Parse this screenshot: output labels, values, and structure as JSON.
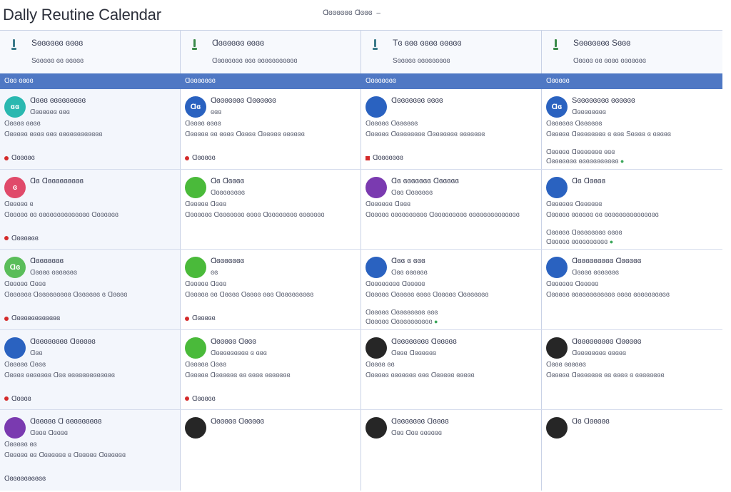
{
  "app": {
    "title": "Dally Reutine Calendar",
    "view_label": "Ɑɞɞɞɞɞɞ Ɑɞɞɞ",
    "caret": "–"
  },
  "colors": {
    "band": "#4f78c4",
    "status_red": "#d42a2a",
    "ok_green": "#3aa65a"
  },
  "columns": [
    {
      "icon": "pin-icon",
      "title": "Sɞɞɞɞɞɞ ɞɞɞɞ",
      "subtitle": "Sɞɞɞɞɞ ɞɞ ɞɞɞɞɞ",
      "band": "Ɑɞɞ ɞɞɞɞ"
    },
    {
      "icon": "pin-icon",
      "title": "Ɑɞɞɞɞɞɞ ɞɞɞɞ",
      "subtitle": "Ɑɞɞɞɞɞɞɞ ɞɞɞ ɞɞɞɞɞɞɞɞɞɞɞ",
      "band": "Ɑɞɞɞɞɞɞɞ"
    },
    {
      "icon": "pin-icon",
      "title": "Tɞ ɞɞɞ ɞɞɞɞ ɞɞɞɞɞ",
      "subtitle": "Sɞɞɞɞɞ ɞɞɞɞɞɞɞɞɞ",
      "band": "Ɑɞɞɞɞɞɞɞ"
    },
    {
      "icon": "pin-icon",
      "title": "Sɞɞɞɞɞɞɞ Sɞɞɞ",
      "subtitle": "Ɑɞɞɞɞ ɞɞ ɞɞɞɞ ɞɞɞɞɞɞɞ",
      "band": "Ɑɞɞɞɞɞ"
    }
  ],
  "rows": [
    [
      {
        "badge_color": "#2ab8b0",
        "badge_text": "ɞɞ",
        "title": "Ɑɞɞɞ ɞɞɞɞɞɞɞɞɞ",
        "sub": "Ɑɞɞɞɞɞɞ ɞɞɞ",
        "line1": "Ɑɞɞɞɞ ɞɞɞɞ",
        "line2": "Ɑɞɞɞɞɞ ɞɞɞɞ ɞɞɞ ɞɞɞɞɞɞɞɞɞɞɞɞ",
        "status": "Ɑɞɞɞɞɞ",
        "marker": "dot"
      },
      {
        "badge_color": "#2a62c0",
        "badge_text": "Ɑɞ",
        "title": "Ɑɞɞɞɞɞɞɞ Ɑɞɞɞɞɞɞ",
        "sub": "ɞɞɞ",
        "line1": "Ɑɞɞɞɞ ɞɞɞɞ",
        "line2": "Ɑɞɞɞɞɞ ɞɞ ɞɞɞɞ Ɑɞɞɞɞ Ɑɞɞɞɞɞ ɞɞɞɞɞɞ",
        "status": "Ɑɞɞɞɞɞ",
        "marker": "dot"
      },
      {
        "badge_color": "#2a62c0",
        "badge_text": "",
        "title": "Ɑɞɞɞɞɞɞɞ ɞɞɞɞ",
        "sub": "",
        "line1": "Ɑɞɞɞɞɞ Ɑɞɞɞɞɞɞ",
        "line2": "Ɑɞɞɞɞɞ Ɑɞɞɞɞɞɞɞɞ Ɑɞɞɞɞɞɞɞ ɞɞɞɞɞɞɞ",
        "status": "Ɑɞɞɞɞɞɞɞ",
        "marker": "sq"
      },
      {
        "badge_color": "#2a62c0",
        "badge_text": "Ɑɞ",
        "title": "Sɞɞɞɞɞɞɞɞ ɞɞɞɞɞɞ",
        "sub": "Ɑɞɞɞɞɞɞɞɞ",
        "line1": "Ɑɞɞɞɞɞɞ Ɑɞɞɞɞɞɞ",
        "line2": "Ɑɞɞɞɞɞ Ɑɞɞɞɞɞɞɞɞ ɞ ɞɞɞ Sɞɞɞɞ ɞ ɞɞɞɞɞ",
        "note1": "Ɑɞɞɞɞɞ Ɑɞɞɞɞɞɞɞ ɞɞɞ",
        "note2": "Ɑɞɞɞɞɞɞɞ ɞɞɞɞɞɞɞɞɞɞɞ",
        "status": "",
        "marker": ""
      }
    ],
    [
      {
        "badge_color": "#e04a6a",
        "badge_text": "ɞ",
        "title": "Ɑɞ Ɑɞɞɞɞɞɞɞɞɞ",
        "sub": "",
        "line1": "Ɑɞɞɞɞɞ ɞ",
        "line2": "Ɑɞɞɞɞɞ ɞɞ ɞɞɞɞɞɞɞɞɞɞɞɞɞɞ Ɑɞɞɞɞɞɞ",
        "status": "Ɑɞɞɞɞɞɞ",
        "marker": "dot"
      },
      {
        "badge_color": "#4aba3a",
        "badge_text": "",
        "title": "Ɑɞ Ɑɞɞɞɞ",
        "sub": "Ɑɞɞɞɞɞɞɞɞ",
        "line1": "Ɑɞɞɞɞɞ Ɑɞɞɞ",
        "line2": "Ɑɞɞɞɞɞɞ Ɑɞɞɞɞɞɞɞ ɞɞɞɞ Ɑɞɞɞɞɞɞɞɞ ɞɞɞɞɞɞɞ",
        "status": "",
        "marker": ""
      },
      {
        "badge_color": "#7a3ab0",
        "badge_text": "",
        "title": "Ɑɞ ɞɞɞɞɞɞɞ Ɑɞɞɞɞɞ",
        "sub": "Ɑɞɞ Ɑɞɞɞɞɞɞ",
        "line1": "Ɑɞɞɞɞɞɞ Ɑɞɞɞ",
        "line2": "Ɑɞɞɞɞɞ ɞɞɞɞɞɞɞɞɞɞ Ɑɞɞɞɞɞɞɞɞɞ ɞɞɞɞɞɞɞɞɞɞɞɞɞɞ",
        "status": "",
        "marker": ""
      },
      {
        "badge_color": "#2a62c0",
        "badge_text": "",
        "title": "Ɑɞ Ɑɞɞɞɞ",
        "sub": "",
        "line1": "Ɑɞɞɞɞɞɞ Ɑɞɞɞɞɞɞ",
        "line2": "Ɑɞɞɞɞɞ ɞɞɞɞɞɞ ɞɞ ɞɞɞɞɞɞɞɞɞɞɞɞɞɞɞ",
        "note1": "Ɑɞɞɞɞɞ Ɑɞɞɞɞɞɞɞɞ ɞɞɞɞ",
        "note2": "Ɑɞɞɞɞɞ ɞɞɞɞɞɞɞɞɞɞ",
        "status": "",
        "marker": ""
      }
    ],
    [
      {
        "badge_color": "#5abd5a",
        "badge_text": "Ɑɞ",
        "title": "Ɑɞɞɞɞɞɞɞ",
        "sub": "Ɑɞɞɞɞ ɞɞɞɞɞɞɞ",
        "line1": "Ɑɞɞɞɞɞ Ɑɞɞɞ",
        "line2": "Ɑɞɞɞɞɞɞ Ɑɞɞɞɞɞɞɞɞɞ Ɑɞɞɞɞɞɞ ɞ Ɑɞɞɞɞ",
        "status": "Ɑɞɞɞɞɞɞɞɞɞɞɞɞ",
        "marker": "dot"
      },
      {
        "badge_color": "#4aba3a",
        "badge_text": "",
        "title": "Ɑɞɞɞɞɞɞɞ",
        "sub": "ɞɞ",
        "line1": "Ɑɞɞɞɞɞ Ɑɞɞɞ",
        "line2": "Ɑɞɞɞɞɞ ɞɞ Ɑɞɞɞɞ Ɑɞɞɞɞ ɞɞɞ Ɑɞɞɞɞɞɞɞɞɞ",
        "status": "Ɑɞɞɞɞɞ",
        "marker": "dot"
      },
      {
        "badge_color": "#2a62c0",
        "badge_text": "",
        "title": "Ɑɞɞ ɞ ɞɞɞ",
        "sub": "Ɑɞɞ ɞɞɞɞɞɞ",
        "line1": "Ɑɞɞɞɞɞɞɞɞ Ɑɞɞɞɞɞ",
        "line2": "Ɑɞɞɞɞɞ Ɑɞɞɞɞɞ ɞɞɞɞ Ɑɞɞɞɞɞ Ɑɞɞɞɞɞɞɞ",
        "note1": "Ɑɞɞɞɞɞ Ɑɞɞɞɞɞɞɞɞ ɞɞɞ",
        "note2": "Ɑɞɞɞɞɞ Ɑɞɞɞɞɞɞɞɞɞɞ",
        "status": "",
        "marker": ""
      },
      {
        "badge_color": "#2a62c0",
        "badge_text": "",
        "title": "Ɑɞɞɞɞɞɞɞɞɞ Ɑɞɞɞɞɞ",
        "sub": "Ɑɞɞɞɞ ɞɞɞɞɞɞɞ",
        "line1": "Ɑɞɞɞɞɞɞ Ɑɞɞɞɞɞ",
        "line2": "Ɑɞɞɞɞɞ ɞɞɞɞɞɞɞɞɞɞɞɞ ɞɞɞɞ ɞɞɞɞɞɞɞɞɞɞ",
        "status": "",
        "marker": ""
      }
    ],
    [
      {
        "badge_color": "#2a62c0",
        "badge_text": "",
        "title": "Ɑɞɞɞɞɞɞɞɞ Ɑɞɞɞɞɞ",
        "sub": "Ɑɞɞ",
        "line1": "Ɑɞɞɞɞɞ Ɑɞɞɞ",
        "line2": "Ɑɞɞɞɞ ɞɞɞɞɞɞɞ Ɑɞɞ ɞɞɞɞɞɞɞɞɞɞɞɞɞ",
        "status": "Ɑɞɞɞɞ",
        "marker": "dot"
      },
      {
        "badge_color": "#4aba3a",
        "badge_text": "",
        "title": "Ɑɞɞɞɞɞ Ɑɞɞɞ",
        "sub": "Ɑɞɞɞɞɞɞɞɞɞ ɞ ɞɞɞ",
        "line1": "Ɑɞɞɞɞɞ Ɑɞɞɞ",
        "line2": "Ɑɞɞɞɞɞ Ɑɞɞɞɞɞɞ ɞɞ ɞɞɞɞ ɞɞɞɞɞɞɞ",
        "status": "Ɑɞɞɞɞɞ",
        "marker": "dot"
      },
      {
        "badge_color": "#262626",
        "badge_text": "",
        "title": "Ɑɞɞɞɞɞɞɞɞ Ɑɞɞɞɞɞ",
        "sub": "Ɑɞɞɞ Ɑɞɞɞɞɞɞ",
        "line1": "Ɑɞɞɞɞ ɞɞ",
        "line2": "Ɑɞɞɞɞɞ ɞɞɞɞɞɞɞ ɞɞɞ Ɑɞɞɞɞɞ ɞɞɞɞɞ",
        "status": "",
        "marker": ""
      },
      {
        "badge_color": "#262626",
        "badge_text": "",
        "title": "Ɑɞɞɞɞɞɞɞɞɞ Ɑɞɞɞɞɞ",
        "sub": "Ɑɞɞɞɞɞɞɞɞ ɞɞɞɞɞ",
        "line1": "Ɑɞɞɞ ɞɞɞɞɞɞ",
        "line2": "Ɑɞɞɞɞɞ Ɑɞɞɞɞɞɞɞ ɞɞ ɞɞɞɞ ɞ ɞɞɞɞɞɞɞɞ",
        "status": "",
        "marker": ""
      }
    ],
    [
      {
        "badge_color": "#7a3ab0",
        "badge_text": "",
        "title": "Ɑɞɞɞɞɞ Ɑ ɞɞɞɞɞɞɞɞɞ",
        "sub": "Ɑɞɞɞ Ɑɞɞɞɞ",
        "line1": "Ɑɞɞɞɞɞ ɞɞ",
        "line2": "Ɑɞɞɞɞɞ ɞɞ Ɑɞɞɞɞɞɞ ɞ Ɑɞɞɞɞɞ Ɑɞɞɞɞɞɞ",
        "status": "Ɑɞɞɞɞɞɞɞɞɞɞ",
        "marker": "none"
      },
      {
        "badge_color": "#262626",
        "badge_text": "",
        "title": "Ɑɞɞɞɞɞ Ɑɞɞɞɞɞ",
        "sub": "",
        "line1": "",
        "line2": "",
        "status": "",
        "marker": ""
      },
      {
        "badge_color": "#262626",
        "badge_text": "",
        "title": "Ɑɞɞɞɞɞɞɞ Ɑɞɞɞɞ",
        "sub": "Ɑɞɞ Ɑɞɞ ɞɞɞɞɞɞ",
        "line1": "",
        "line2": "",
        "status": "",
        "marker": ""
      },
      {
        "badge_color": "#262626",
        "badge_text": "",
        "title": "Ɑɞ Ɑɞɞɞɞɞ",
        "sub": "",
        "line1": "",
        "line2": "",
        "status": "",
        "marker": ""
      }
    ]
  ]
}
